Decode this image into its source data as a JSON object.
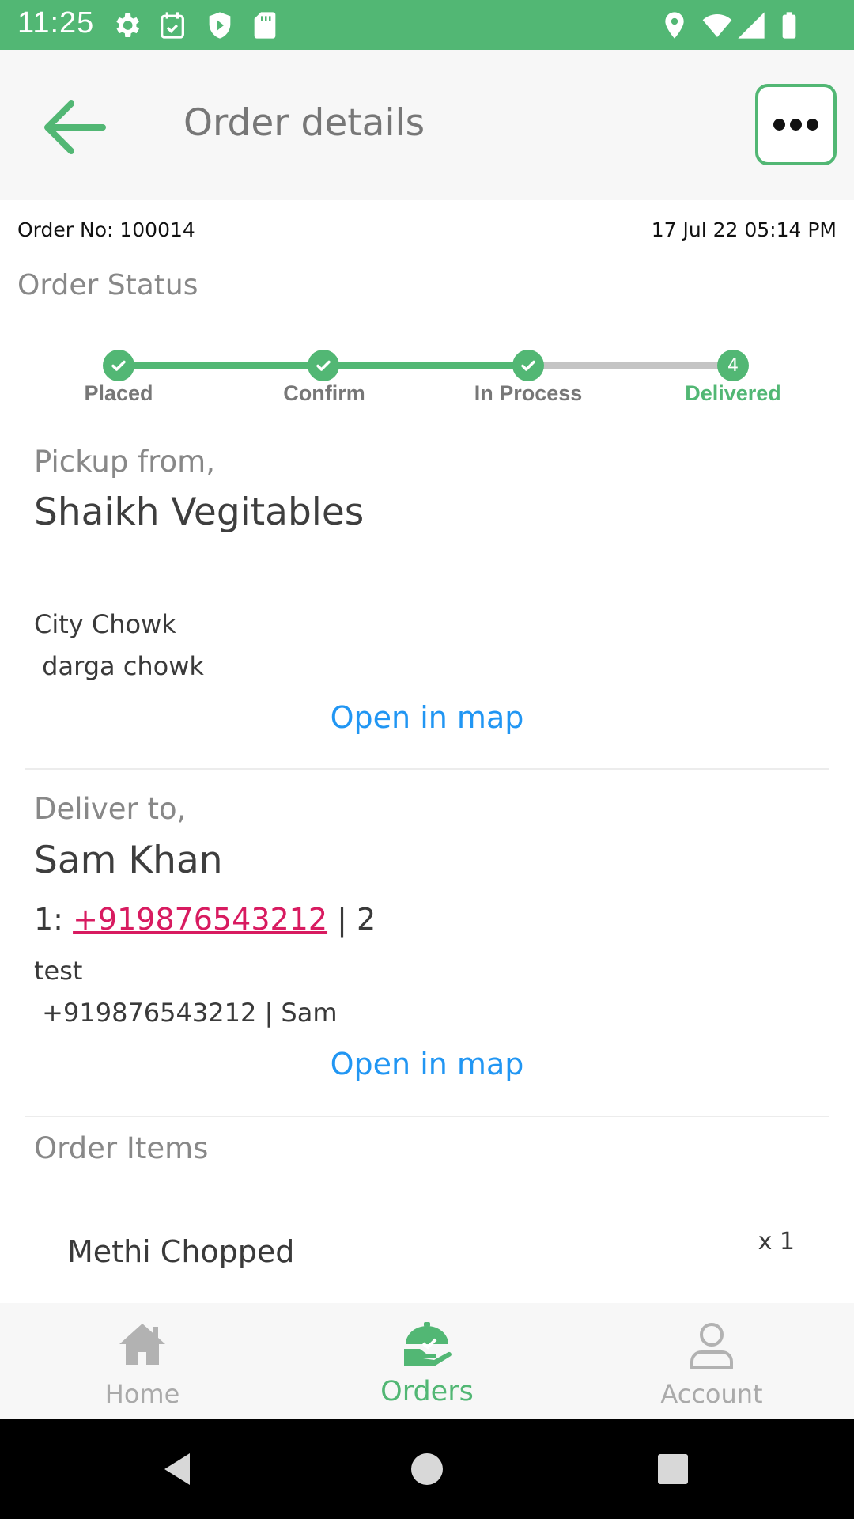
{
  "status_bar": {
    "time": "11:25",
    "icons_left": [
      "settings-icon",
      "calendar-check-icon",
      "shield-play-icon",
      "sd-card-icon"
    ],
    "icons_right": [
      "location-icon",
      "wifi-icon",
      "cellular-signal-icon",
      "battery-icon"
    ],
    "color": "#52b774"
  },
  "header": {
    "title": "Order details",
    "back_icon": "arrow-left-icon",
    "more_icon": "more-horizontal-icon"
  },
  "order": {
    "number_label": "Order No: 100014",
    "date": "17 Jul 22 05:14 PM",
    "status_label": "Order Status"
  },
  "stepper": {
    "steps": [
      {
        "label": "Placed",
        "state": "done",
        "marker": ""
      },
      {
        "label": "Confirm",
        "state": "done",
        "marker": ""
      },
      {
        "label": "In Process",
        "state": "done",
        "marker": ""
      },
      {
        "label": "Delivered",
        "state": "current",
        "marker": "4"
      }
    ],
    "accent": "#52b774"
  },
  "pickup": {
    "label": "Pickup from,",
    "name": "Shaikh Vegitables",
    "address_line1": "City Chowk",
    "address_line2": " darga chowk",
    "map_link": "Open in map"
  },
  "delivery": {
    "label": "Deliver to,",
    "name": "Sam Khan",
    "phone_prefix": "1:",
    "phone": "+919876543212",
    "phone_suffix": "| 2",
    "address_line1": "test",
    "address_line2": " +919876543212 | Sam",
    "map_link": "Open in map"
  },
  "items": {
    "label": "Order Items",
    "list": [
      {
        "name": "Methi Chopped",
        "qty": "x 1"
      }
    ]
  },
  "bottom_nav": {
    "items": [
      {
        "label": "Home",
        "icon": "home-icon",
        "active": false
      },
      {
        "label": "Orders",
        "icon": "orders-icon",
        "active": true
      },
      {
        "label": "Account",
        "icon": "account-icon",
        "active": false
      }
    ]
  },
  "system_nav": {
    "icons": [
      "back-triangle-icon",
      "home-circle-icon",
      "recents-square-icon"
    ]
  }
}
